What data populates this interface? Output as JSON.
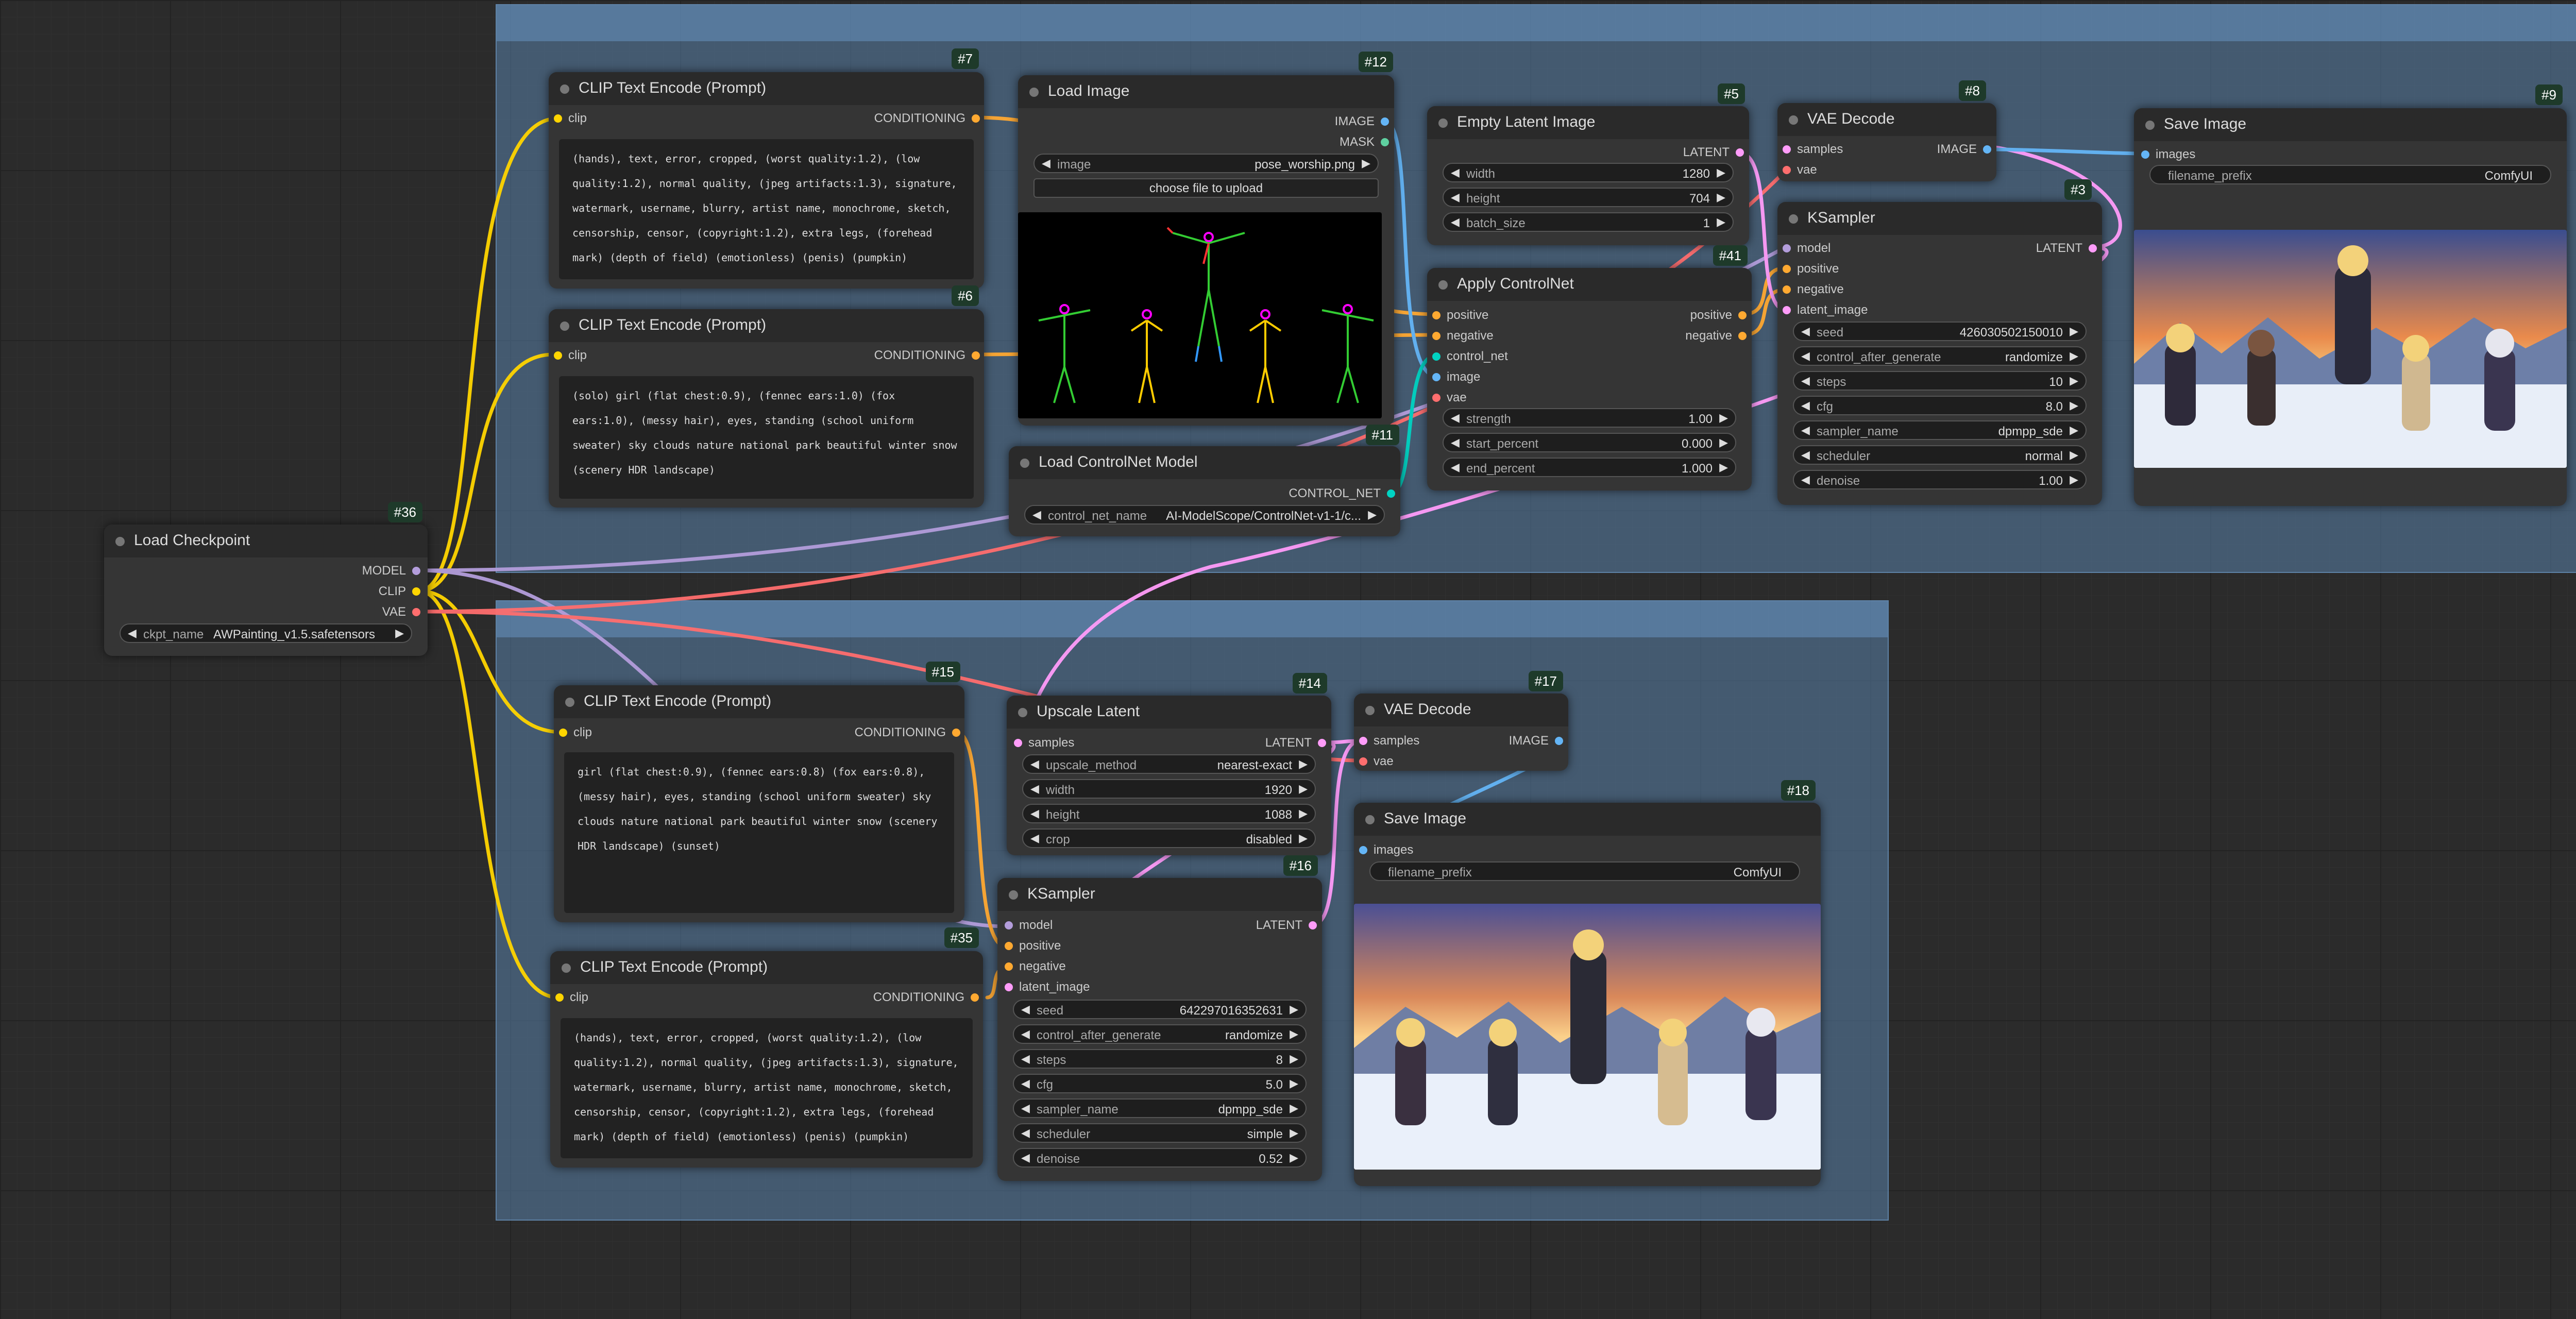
{
  "groups": [
    {
      "title": ""
    },
    {
      "title": ""
    }
  ],
  "stats": "",
  "nodes": {
    "load_checkpoint": {
      "badge": "#36",
      "title": "Load Checkpoint",
      "out_model": "MODEL",
      "out_clip": "CLIP",
      "out_vae": "VAE",
      "ckpt_label": "ckpt_name",
      "ckpt_value": "AWPainting_v1.5.safetensors"
    },
    "clip7": {
      "badge": "#7",
      "title": "CLIP Text Encode (Prompt)",
      "in_clip": "clip",
      "out": "CONDITIONING",
      "text": "(hands), text, error, cropped, (worst quality:1.2), (low quality:1.2), normal quality, (jpeg artifacts:1.3), signature, watermark, username, blurry, artist name, monochrome, sketch, censorship, censor, (copyright:1.2), extra legs, (forehead mark) (depth of field) (emotionless) (penis) (pumpkin)"
    },
    "clip6": {
      "badge": "#6",
      "title": "CLIP Text Encode (Prompt)",
      "in_clip": "clip",
      "out": "CONDITIONING",
      "text": "(solo) girl (flat chest:0.9), (fennec ears:1.0)  (fox ears:1.0), (messy hair), eyes, standing (school uniform sweater) sky clouds nature national park beautiful winter snow (scenery HDR landscape)"
    },
    "load_image": {
      "badge": "#12",
      "title": "Load Image",
      "out_image": "IMAGE",
      "out_mask": "MASK",
      "image_label": "image",
      "image_value": "pose_worship.png",
      "upload_label": "choose file to upload"
    },
    "controlnet_loader": {
      "badge": "#11",
      "title": "Load ControlNet Model",
      "out": "CONTROL_NET",
      "label": "control_net_name",
      "value": "AI-ModelScope/ControlNet-v1-1/c..."
    },
    "empty_latent": {
      "badge": "#5",
      "title": "Empty Latent Image",
      "out": "LATENT",
      "widgets": [
        {
          "label": "width",
          "value": "1280"
        },
        {
          "label": "height",
          "value": "704"
        },
        {
          "label": "batch_size",
          "value": "1"
        }
      ]
    },
    "apply_controlnet": {
      "badge": "#41",
      "title": "Apply ControlNet",
      "inputs": [
        "positive",
        "negative",
        "control_net",
        "image",
        "vae"
      ],
      "out_positive": "positive",
      "out_negative": "negative",
      "widgets": [
        {
          "label": "strength",
          "value": "1.00"
        },
        {
          "label": "start_percent",
          "value": "0.000"
        },
        {
          "label": "end_percent",
          "value": "1.000"
        }
      ]
    },
    "vae_decode8": {
      "badge": "#8",
      "title": "VAE Decode",
      "in_samples": "samples",
      "in_vae": "vae",
      "out": "IMAGE"
    },
    "ksampler3": {
      "badge": "#3",
      "title": "KSampler",
      "inputs": [
        "model",
        "positive",
        "negative",
        "latent_image"
      ],
      "out": "LATENT",
      "widgets": [
        {
          "label": "seed",
          "value": "426030502150010"
        },
        {
          "label": "control_after_generate",
          "value": "randomize"
        },
        {
          "label": "steps",
          "value": "10"
        },
        {
          "label": "cfg",
          "value": "8.0"
        },
        {
          "label": "sampler_name",
          "value": "dpmpp_sde"
        },
        {
          "label": "scheduler",
          "value": "normal"
        },
        {
          "label": "denoise",
          "value": "1.00"
        }
      ]
    },
    "save9": {
      "badge": "#9",
      "title": "Save Image",
      "in_images": "images",
      "label": "filename_prefix",
      "value": "ComfyUI"
    },
    "clip15": {
      "badge": "#15",
      "title": "CLIP Text Encode (Prompt)",
      "in_clip": "clip",
      "out": "CONDITIONING",
      "text": "girl (flat chest:0.9), (fennec ears:0.8)  (fox ears:0.8), (messy hair), eyes, standing (school uniform sweater) sky clouds nature national park beautiful winter snow (scenery HDR landscape) (sunset)"
    },
    "clip35": {
      "badge": "#35",
      "title": "CLIP Text Encode (Prompt)",
      "in_clip": "clip",
      "out": "CONDITIONING",
      "text": "(hands), text, error, cropped, (worst quality:1.2), (low quality:1.2), normal quality, (jpeg artifacts:1.3), signature, watermark, username, blurry, artist name, monochrome, sketch, censorship, censor, (copyright:1.2), extra legs, (forehead mark) (depth of field) (emotionless) (penis) (pumpkin)"
    },
    "upscale14": {
      "badge": "#14",
      "title": "Upscale Latent",
      "in_samples": "samples",
      "out": "LATENT",
      "widgets": [
        {
          "label": "upscale_method",
          "value": "nearest-exact"
        },
        {
          "label": "width",
          "value": "1920"
        },
        {
          "label": "height",
          "value": "1088"
        },
        {
          "label": "crop",
          "value": "disabled"
        }
      ]
    },
    "ksampler16": {
      "badge": "#16",
      "title": "KSampler",
      "inputs": [
        "model",
        "positive",
        "negative",
        "latent_image"
      ],
      "out": "LATENT",
      "widgets": [
        {
          "label": "seed",
          "value": "642297016352631"
        },
        {
          "label": "control_after_generate",
          "value": "randomize"
        },
        {
          "label": "steps",
          "value": "8"
        },
        {
          "label": "cfg",
          "value": "5.0"
        },
        {
          "label": "sampler_name",
          "value": "dpmpp_sde"
        },
        {
          "label": "scheduler",
          "value": "simple"
        },
        {
          "label": "denoise",
          "value": "0.52"
        }
      ]
    },
    "vae_decode17": {
      "badge": "#17",
      "title": "VAE Decode",
      "in_samples": "samples",
      "in_vae": "vae",
      "out": "IMAGE"
    },
    "save18": {
      "badge": "#18",
      "title": "Save Image",
      "in_images": "images",
      "label": "filename_prefix",
      "value": "ComfyUI"
    }
  },
  "colors": {
    "model": "#b39ddb",
    "clip": "#ffd500",
    "vae": "#ff6e6e",
    "conditioning": "#ffa931",
    "latent": "#ff9cf9",
    "image": "#64b5f6",
    "control_net": "#00d3c2",
    "group": "#5a82aa"
  }
}
